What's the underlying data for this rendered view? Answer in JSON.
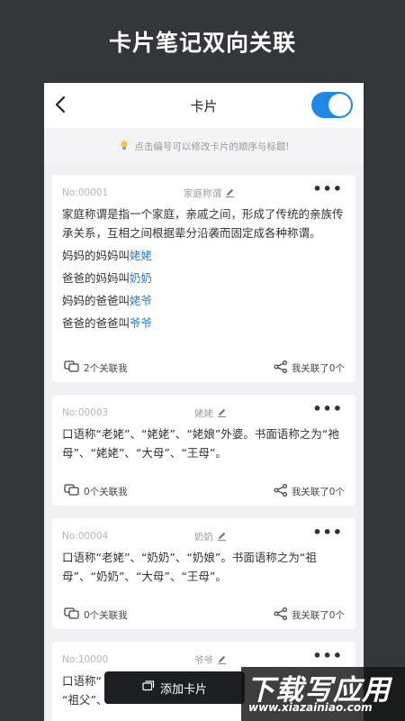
{
  "headline": "卡片笔记双向关联",
  "navbar": {
    "title": "卡片",
    "toggle_on": true
  },
  "tip": {
    "text": "点击编号可以修改卡片的顺序与标题!"
  },
  "cards": [
    {
      "no": "No:00001",
      "title": "家庭称谓",
      "text": "家庭称谓是指一个家庭，亲戚之间，形成了传统的亲族传承关系，互相之间根据辈分沿袭而固定成各种称谓。",
      "lines": [
        {
          "prefix": "妈妈的妈妈叫",
          "kin": "姥姥"
        },
        {
          "prefix": "爸爸的妈妈叫",
          "kin": "奶奶"
        },
        {
          "prefix": "妈妈的爸爸叫",
          "kin": "姥爷"
        },
        {
          "prefix": "爸爸的爸爸叫",
          "kin": "爷爷"
        }
      ],
      "linked_by": "2个关联我",
      "links": "我关联了0个"
    },
    {
      "no": "No:00003",
      "title": "姥姥",
      "text": "口语称“老姥”、“姥姥”、“姥娘”外婆。书面语称之为“祂母”、“姥姥”、“大母”、“王母”。",
      "linked_by": "0个关联我",
      "links": "我关联了0个"
    },
    {
      "no": "No:00004",
      "title": "奶奶",
      "text": "口语称“老姥”、“奶奶”、“奶娘”。书面语称之为“祖母”、“奶奶”、“大母”、“王母”。",
      "linked_by": "0个关联我",
      "links": "我关联了0个"
    },
    {
      "no": "No:10000",
      "title": "爷爷",
      "text_a": "口语称“",
      "text_b": "“祖父”、"
    }
  ],
  "add_button": "添加卡片",
  "watermark": {
    "big": "下载写应用",
    "small": "www.xiazainiao.com"
  },
  "colors": {
    "accent": "#1e88e5",
    "link": "#1e7fd6",
    "background": "#33373a"
  },
  "icons": [
    "back-arrow-icon",
    "lightbulb-icon",
    "edit-pencil-icon",
    "more-dots-icon",
    "link-cards-icon",
    "share-nodes-icon",
    "card-add-icon"
  ]
}
